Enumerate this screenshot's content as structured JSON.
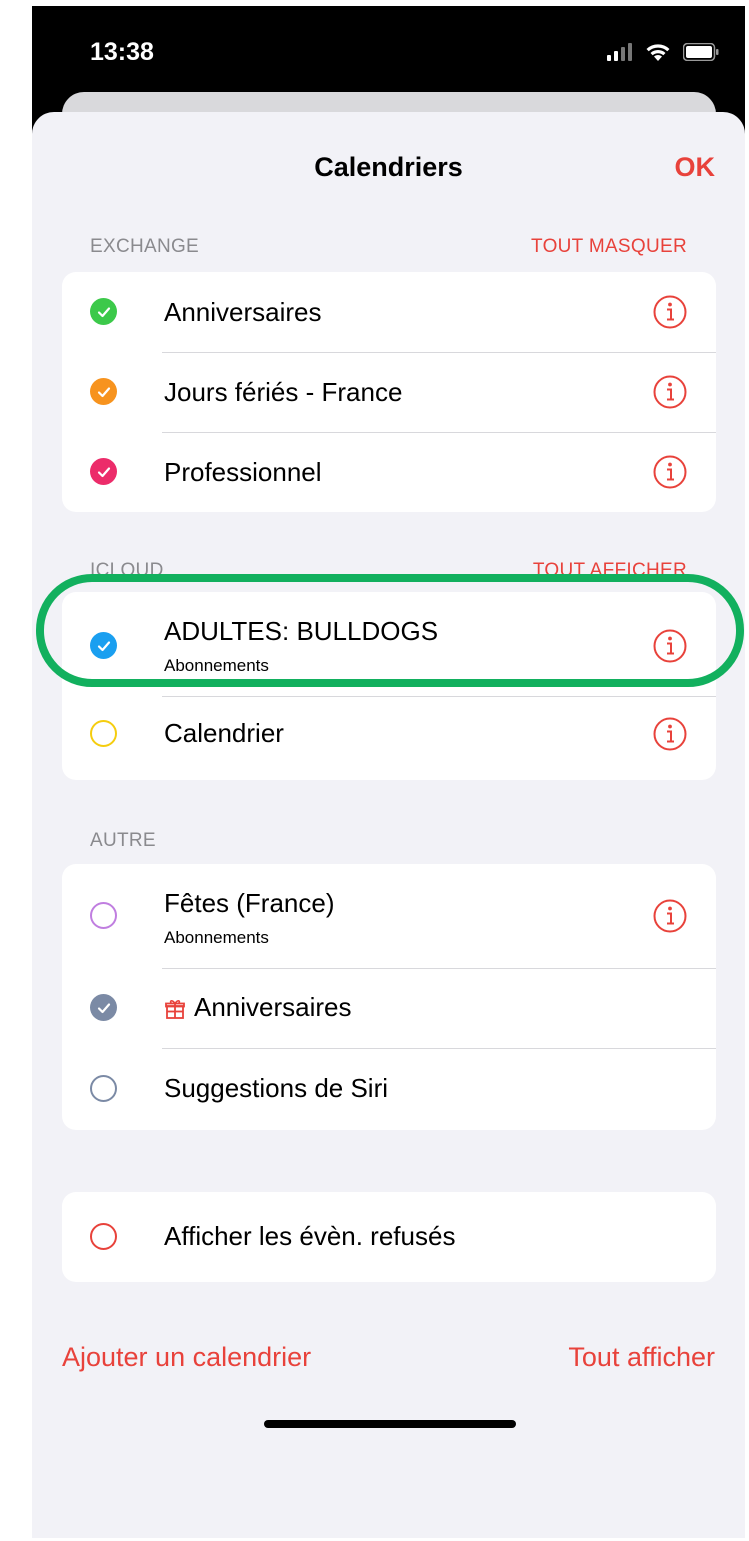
{
  "status": {
    "time": "13:38"
  },
  "nav": {
    "title": "Calendriers",
    "done": "OK"
  },
  "exchange": {
    "header": "EXCHANGE",
    "action": "TOUT MASQUER",
    "items": [
      {
        "label": "Anniversaires",
        "color": "#3cc94a",
        "checked": true
      },
      {
        "label": "Jours fériés - France",
        "color": "#f7931e",
        "checked": true
      },
      {
        "label": "Professionnel",
        "color": "#ec2c6a",
        "checked": true
      }
    ]
  },
  "icloud": {
    "header": "ICLOUD",
    "action": "TOUT AFFICHER",
    "items": [
      {
        "label": "ADULTES: BULLDOGS",
        "sublabel": "Abonnements",
        "color": "#1a9ff0",
        "checked": true
      },
      {
        "label": "Calendrier",
        "color": "#f5cd0f",
        "checked": false
      }
    ]
  },
  "autre": {
    "header": "AUTRE",
    "items": [
      {
        "label": "Fêtes (France)",
        "sublabel": "Abonnements",
        "color": "#c07ee0",
        "checked": false
      },
      {
        "label": "Anniversaires",
        "color": "#7b8aa5",
        "checked": true,
        "icon": "gift-icon"
      },
      {
        "label": "Suggestions de Siri",
        "color": "#7b8aa5",
        "checked": false
      }
    ]
  },
  "declined": {
    "label": "Afficher les évèn. refusés",
    "color": "#e8423b",
    "checked": false
  },
  "footer": {
    "add_calendar": "Ajouter un calendrier",
    "show_all": "Tout afficher"
  },
  "accent_color": "#e8423b",
  "highlight_color": "#12b05e"
}
